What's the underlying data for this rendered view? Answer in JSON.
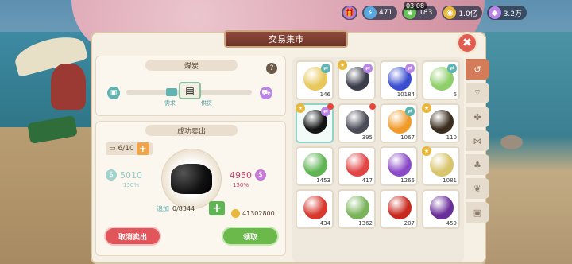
{
  "hud": {
    "time": "03:08",
    "resources": [
      {
        "icon": "gift-icon",
        "value": "",
        "color": "#b07bd6"
      },
      {
        "icon": "lightning-icon",
        "value": "471",
        "color": "#5aa8e0"
      },
      {
        "icon": "leaf-icon",
        "value": "183",
        "color": "#6bc15a"
      },
      {
        "icon": "coin-icon",
        "value": "1.0亿",
        "color": "#e8b83a"
      },
      {
        "icon": "gem-icon",
        "value": "3.2万",
        "color": "#b986e6"
      }
    ]
  },
  "window": {
    "title": "交易集市",
    "close_label": "✖"
  },
  "price_section": {
    "title": "煤炭",
    "help": "?",
    "demand_label": "需求",
    "supply_label": "供货"
  },
  "sale_section": {
    "title": "成功卖出",
    "count": "6/10",
    "left_price": "5010",
    "left_pct": "150%",
    "right_price": "4950",
    "right_pct": "150%",
    "add_label": "追加",
    "add_value": "0/8344",
    "gold": "41302800",
    "cancel_label": "取消卖出",
    "claim_label": "领取"
  },
  "inventory": [
    {
      "name": "corn",
      "qty": "146",
      "color": "#e8c85a",
      "badge": "teal"
    },
    {
      "name": "ore",
      "qty": "",
      "color": "#3a3d4a",
      "badge": "purple",
      "star": true
    },
    {
      "name": "blueberry",
      "qty": "10184",
      "color": "#3a4ed0",
      "badge": "purple"
    },
    {
      "name": "cabbage",
      "qty": "6",
      "color": "#8fcf6a",
      "badge": "teal"
    },
    {
      "name": "coal",
      "qty": "",
      "color": "#141414",
      "badge": "purple",
      "star": true,
      "dot": true,
      "selected": true
    },
    {
      "name": "stone-coal",
      "qty": "395",
      "color": "#4a4d58",
      "dot": true
    },
    {
      "name": "pumpkin",
      "qty": "1067",
      "color": "#f09a2a",
      "badge": "teal"
    },
    {
      "name": "beetle",
      "qty": "110",
      "color": "#3a2d1e",
      "star": true
    },
    {
      "name": "zucchini",
      "qty": "1453",
      "color": "#5fb454"
    },
    {
      "name": "strawberry",
      "qty": "417",
      "color": "#e24444"
    },
    {
      "name": "purple-yam",
      "qty": "1266",
      "color": "#8a4ac8"
    },
    {
      "name": "corn-cob",
      "qty": "1081",
      "color": "#d8c46a",
      "star": true
    },
    {
      "name": "tomato",
      "qty": "434",
      "color": "#d8382e"
    },
    {
      "name": "greens",
      "qty": "1362",
      "color": "#7ab45a"
    },
    {
      "name": "chili",
      "qty": "207",
      "color": "#c8281e"
    },
    {
      "name": "eggplant",
      "qty": "459",
      "color": "#6a2e9a"
    }
  ],
  "tabs": [
    "history-icon",
    "shell-icon",
    "pawprint-icon",
    "fish-icon",
    "plant-icon",
    "leaf-icon",
    "box-icon"
  ]
}
